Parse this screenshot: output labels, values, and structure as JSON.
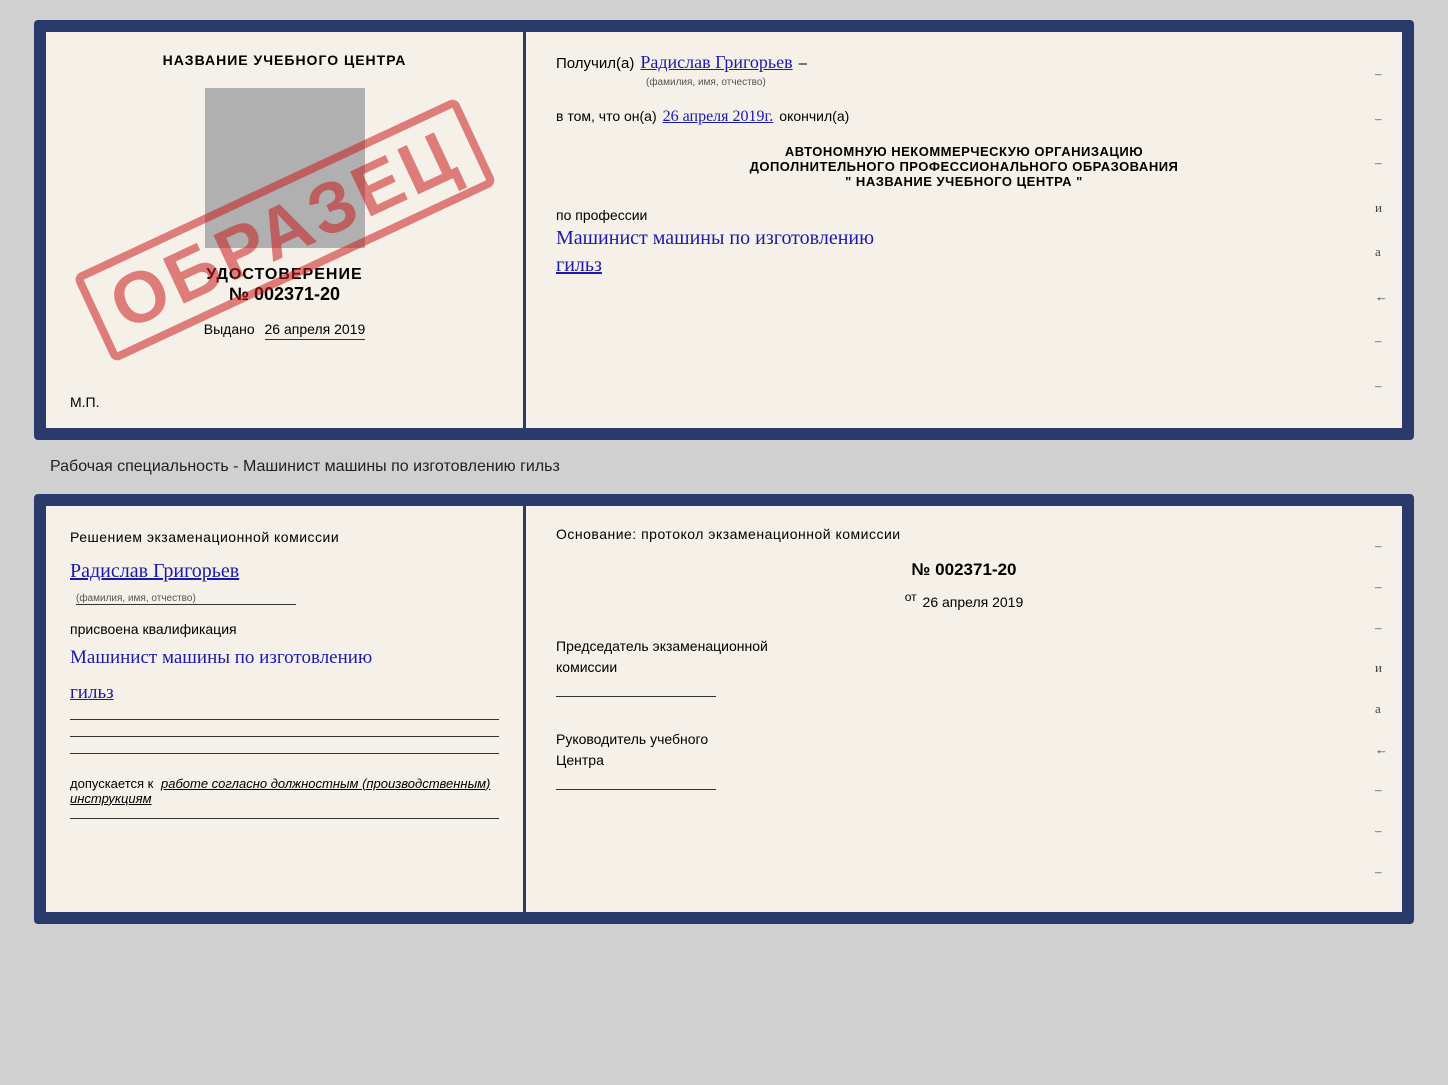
{
  "top_doc": {
    "left": {
      "title": "НАЗВАНИЕ УЧЕБНОГО ЦЕНТРА",
      "cert_label": "УДОСТОВЕРЕНИЕ",
      "cert_number": "№ 002371-20",
      "issued_text": "Выдано",
      "issued_date": "26 апреля 2019",
      "mp": "М.П.",
      "stamp": "ОБРАЗЕЦ"
    },
    "right": {
      "poluchil_label": "Получил(а)",
      "poluchil_name": "Радислав Григорьев",
      "fio_sub": "(фамилия, имя, отчество)",
      "vtom_label": "в том, что он(а)",
      "vtom_date": "26 апреля 2019г.",
      "okonchil": "окончил(а)",
      "org_line1": "АВТОНОМНУЮ НЕКОММЕРЧЕСКУЮ ОРГАНИЗАЦИЮ",
      "org_line2": "ДОПОЛНИТЕЛЬНОГО ПРОФЕССИОНАЛЬНОГО ОБРАЗОВАНИЯ",
      "org_quote": "\" НАЗВАНИЕ УЧЕБНОГО ЦЕНТРА \"",
      "po_professii": "по профессии",
      "profession_line1": "Машинист машины по изготовлению",
      "profession_line2": "гильз",
      "dashes": [
        "-",
        "-",
        "-",
        "и",
        "а",
        "←",
        "-",
        "-"
      ]
    }
  },
  "middle_label": "Рабочая специальность - Машинист машины по изготовлению гильз",
  "bottom_doc": {
    "left": {
      "resheniem": "Решением  экзаменационной  комиссии",
      "name": "Радислав Григорьев",
      "fio_sub": "(фамилия, имя, отчество)",
      "prisvoena": "присвоена квалификация",
      "kvalif_line1": "Машинист машины по изготовлению",
      "kvalif_line2": "гильз",
      "dopuskaetsya_prefix": "допускается к",
      "dopuskaetsya_text": "работе согласно должностным (производственным) инструкциям"
    },
    "right": {
      "osnov": "Основание: протокол экзаменационной комиссии",
      "number": "№  002371-20",
      "ot_label": "от",
      "ot_date": "26 апреля 2019",
      "predsedatel_line1": "Председатель экзаменационной",
      "predsedatel_line2": "комиссии",
      "rukovoditel_line1": "Руководитель учебного",
      "rukovoditel_line2": "Центра",
      "dashes": [
        "-",
        "-",
        "-",
        "и",
        "а",
        "←",
        "-",
        "-",
        "-"
      ]
    }
  }
}
